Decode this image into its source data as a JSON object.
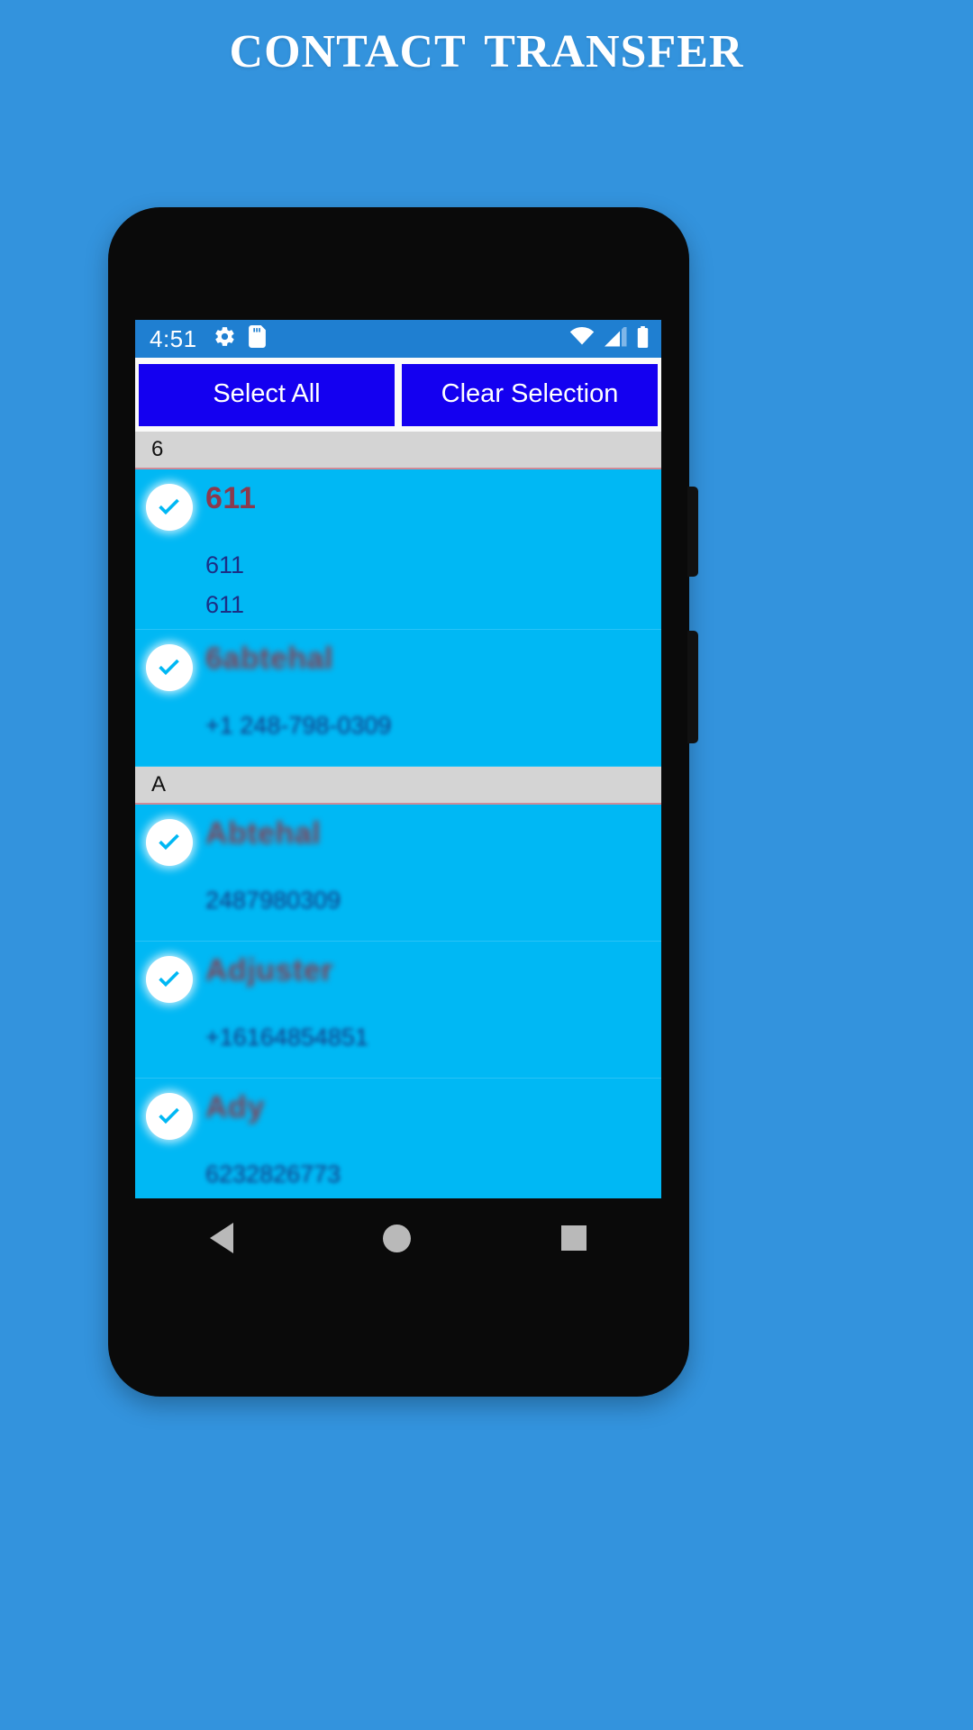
{
  "page": {
    "title": "Contact Transfer",
    "background_color": "#3393dd",
    "title_color": "#ffffff"
  },
  "statusbar": {
    "time": "4:51",
    "left_icons": [
      "gear-icon",
      "sd-card-icon"
    ],
    "right_icons": [
      "wifi-icon",
      "cellular-signal-icon",
      "battery-icon"
    ],
    "background_color": "#1f7fd1"
  },
  "toolbar": {
    "select_all_label": "Select All",
    "clear_selection_label": "Clear Selection",
    "button_color": "#1400f0"
  },
  "list": {
    "selected_color": "#00b8f4",
    "section_header_color": "#d4d4d4",
    "sections": [
      {
        "header": "6",
        "contacts": [
          {
            "name": "611",
            "selected": true,
            "phones": [
              "611",
              "611"
            ],
            "blurred": false
          },
          {
            "name": "6abtehal",
            "selected": true,
            "phones": [
              "+1 248-798-0309"
            ],
            "blurred": true
          }
        ]
      },
      {
        "header": "A",
        "contacts": [
          {
            "name": "Abtehal",
            "selected": true,
            "phones": [
              "2487980309"
            ],
            "blurred": true
          },
          {
            "name": "Adjuster",
            "selected": true,
            "phones": [
              "+16164854851"
            ],
            "blurred": true
          },
          {
            "name": "Ady",
            "selected": true,
            "phones": [
              "6232826773"
            ],
            "blurred": true
          }
        ]
      }
    ]
  },
  "pager": {
    "prev_label": "",
    "next_label": "",
    "middle_label": "",
    "prev_icon": "triangle-left-icon",
    "next_icon": "triangle-right-icon",
    "button_color": "#1400f0",
    "middle_color": "#00b8f4"
  },
  "navbar": {
    "back": "back-triangle-icon",
    "home": "home-circle-icon",
    "recents": "recents-square-icon"
  }
}
